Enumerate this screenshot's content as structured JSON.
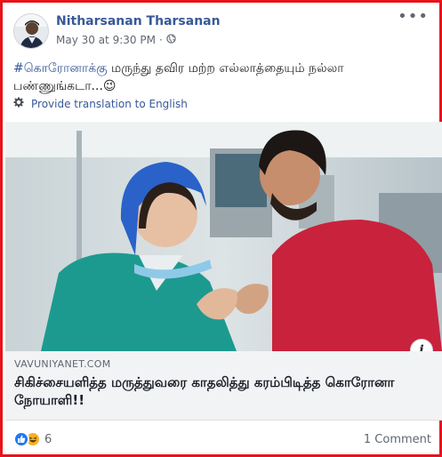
{
  "post": {
    "author": "Nitharsanan Tharsanan",
    "timestamp": "May 30 at 9:30 PM",
    "separator": "·",
    "privacy_icon": "globe-icon",
    "more_icon": "more-options-icon",
    "text_hashtag": "#கொரோனாக்கு",
    "text_body": " மருந்து தவிர மற்ற எல்லாத்தையும் நல்லா பண்ணுங்கடா...😉",
    "translate_label": "Provide translation to English",
    "translate_icon": "gear-icon"
  },
  "link_preview": {
    "domain": "VAVUNIYANET.COM",
    "title": "சிகிச்சையளித்த மருத்துவரை காதலித்து கரம்பிடித்த கொரோனா நோயாளி!!",
    "info_label": "i"
  },
  "footer": {
    "reactions": [
      "like",
      "haha"
    ],
    "reaction_count": "6",
    "comments": "1 Comment"
  },
  "colors": {
    "border": "#e8131b",
    "link": "#385898",
    "muted": "#616770",
    "like": "#2078f4",
    "haha": "#f7b125"
  }
}
